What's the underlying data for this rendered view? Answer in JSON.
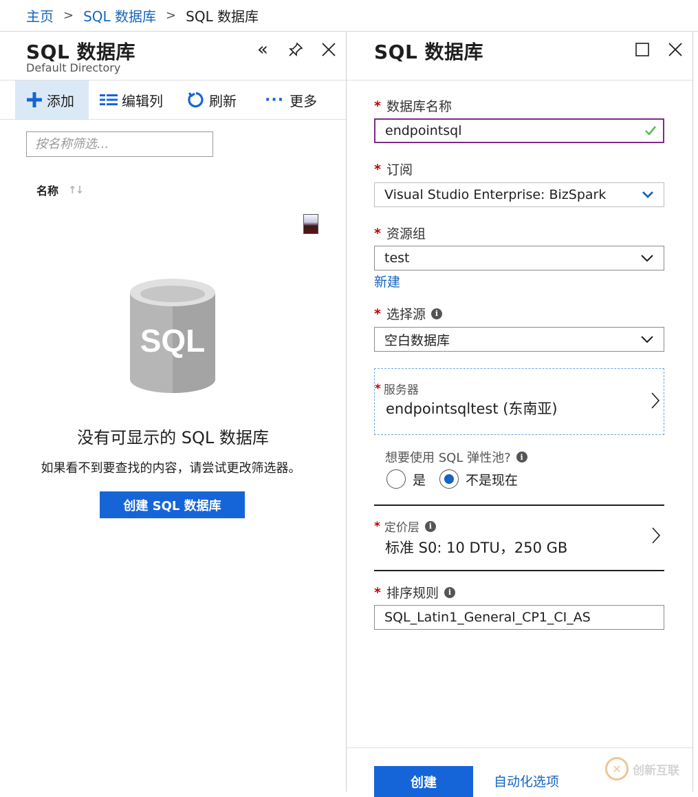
{
  "breadcrumb": {
    "items": [
      "主页",
      "SQL 数据库",
      "SQL 数据库"
    ]
  },
  "left_blade": {
    "title": "SQL 数据库",
    "subtitle": "Default Directory",
    "toolbar": {
      "add": "添加",
      "edit_columns": "编辑列",
      "refresh": "刷新",
      "more": "更多"
    },
    "filter_placeholder": "按名称筛选...",
    "column_name": "名称",
    "illustration_text": "SQL",
    "empty_title": "没有可显示的 SQL 数据库",
    "empty_desc": "如果看不到要查找的内容，请尝试更改筛选器。",
    "create_button": "创建 SQL 数据库"
  },
  "right_blade": {
    "title": "SQL 数据库",
    "db_name": {
      "label": "数据库名称",
      "value": "endpointsql"
    },
    "subscription": {
      "label": "订阅",
      "value": "Visual Studio Enterprise: BizSpark"
    },
    "resource_group": {
      "label": "资源组",
      "value": "test",
      "new_link": "新建"
    },
    "source": {
      "label": "选择源",
      "value": "空白数据库"
    },
    "server": {
      "label": "服务器",
      "value": "endpointsqltest (东南亚)"
    },
    "elastic_pool": {
      "label": "想要使用 SQL 弹性池?",
      "options": [
        "是",
        "不是现在"
      ],
      "selected": "不是现在"
    },
    "pricing_tier": {
      "label": "定价层",
      "value": "标准 S0: 10 DTU，250 GB"
    },
    "collation": {
      "label": "排序规则",
      "value": "SQL_Latin1_General_CP1_CI_AS"
    },
    "create_button": "创建",
    "automation_link": "自动化选项"
  },
  "watermark": {
    "text": "创新互联"
  },
  "colors": {
    "accent": "#1565d8",
    "link": "#1565c0",
    "required": "#c00000",
    "valid_border": "#7b2a8c",
    "check": "#5cb85c"
  }
}
